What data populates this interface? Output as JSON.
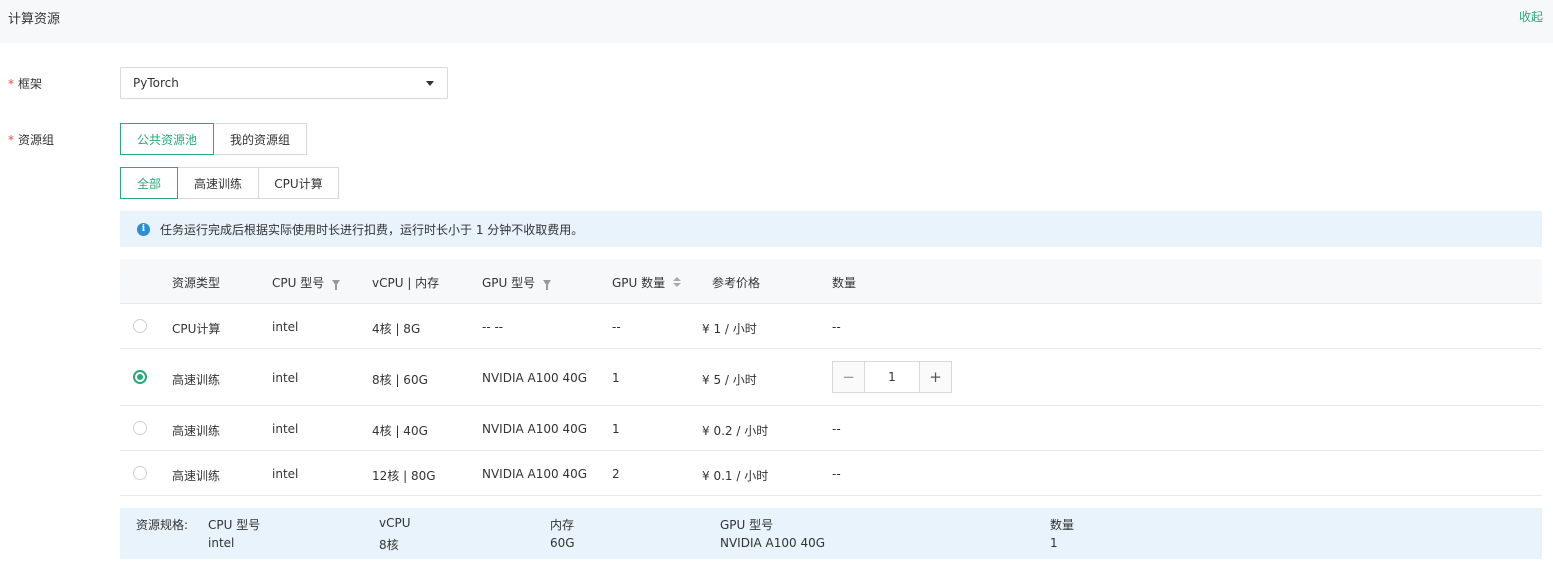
{
  "header": {
    "title": "计算资源",
    "collapse_label": "收起"
  },
  "framework": {
    "required_mark": "*",
    "label": "框架",
    "value": "PyTorch"
  },
  "resource_group": {
    "required_mark": "*",
    "label": "资源组",
    "pool_tabs": [
      "公共资源池",
      "我的资源组"
    ],
    "type_tabs": [
      "全部",
      "高速训练",
      "CPU计算"
    ]
  },
  "notice": {
    "icon": "info-icon",
    "text": "任务运行完成后根据实际使用时长进行扣费，运行时长小于 1 分钟不收取费用。"
  },
  "table": {
    "columns": [
      "资源类型",
      "CPU 型号",
      "vCPU | 内存",
      "GPU 型号",
      "GPU 数量",
      "参考价格",
      "数量"
    ],
    "rows": [
      {
        "type": "CPU计算",
        "cpu": "intel",
        "vcpu_mem": "4核 | 8G",
        "gpu": "-- --",
        "gpu_count": "--",
        "price": "¥ 1 / 小时",
        "qty": "--",
        "selected": false
      },
      {
        "type": "高速训练",
        "cpu": "intel",
        "vcpu_mem": "8核 | 60G",
        "gpu": "NVIDIA A100 40G",
        "gpu_count": "1",
        "price": "¥ 5 / 小时",
        "qty": "1",
        "selected": true
      },
      {
        "type": "高速训练",
        "cpu": "intel",
        "vcpu_mem": "4核 | 40G",
        "gpu": "NVIDIA A100 40G",
        "gpu_count": "1",
        "price": "¥ 0.2 / 小时",
        "qty": "--",
        "selected": false
      },
      {
        "type": "高速训练",
        "cpu": "intel",
        "vcpu_mem": "12核 | 80G",
        "gpu": "NVIDIA A100 40G",
        "gpu_count": "2",
        "price": "¥ 0.1 / 小时",
        "qty": "--",
        "selected": false
      }
    ],
    "stepper": {
      "minus": "−",
      "plus": "+"
    }
  },
  "spec": {
    "label": "资源规格:",
    "headers": [
      "CPU 型号",
      "vCPU",
      "内存",
      "GPU 型号",
      "数量"
    ],
    "values": [
      "intel",
      "8核",
      "60G",
      "NVIDIA A100 40G",
      "1"
    ]
  },
  "colors": {
    "accent": "#2aa87a",
    "required": "#e84a4a",
    "info": "#2b8fd8",
    "notice_bg": "#e8f3fb"
  }
}
